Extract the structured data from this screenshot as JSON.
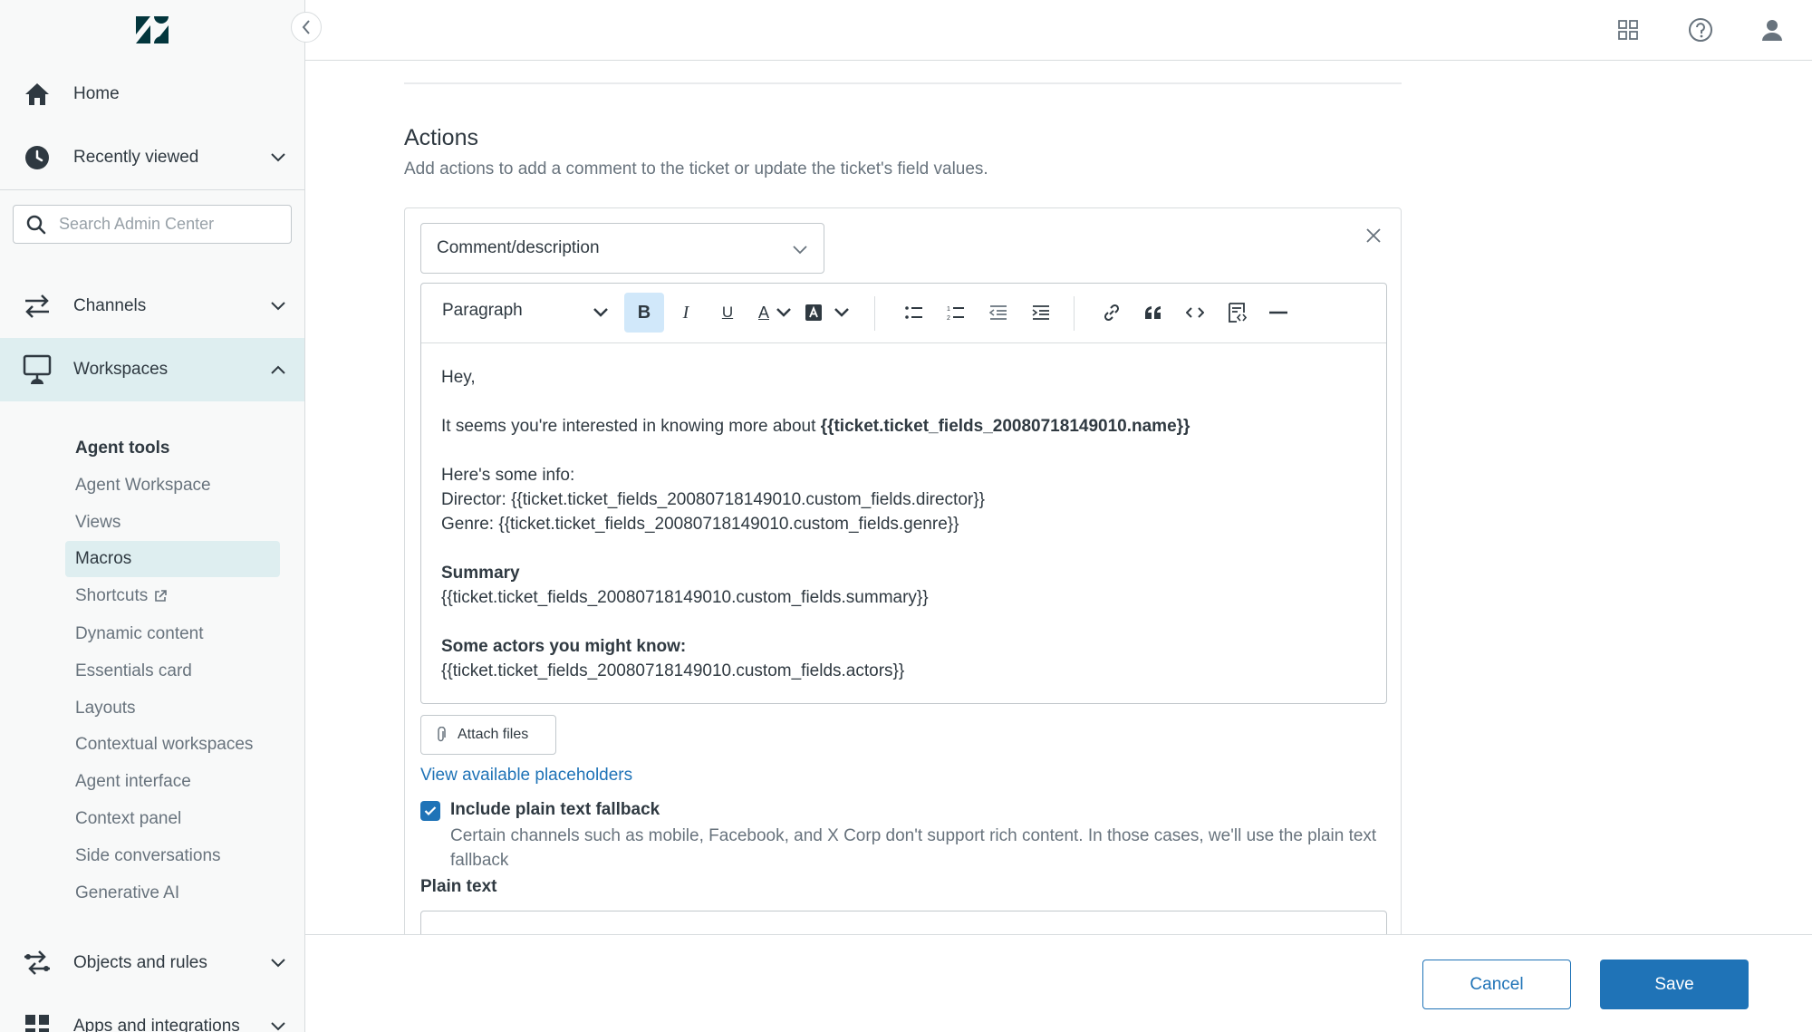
{
  "sidebar": {
    "logo": "zendesk-logo",
    "collapse_icon": "chevron-left-icon",
    "nav": {
      "home": "Home",
      "recently_viewed": "Recently viewed",
      "channels": "Channels",
      "workspaces": "Workspaces",
      "objects_rules": "Objects and rules",
      "apps_integrations": "Apps and integrations"
    },
    "search_placeholder": "Search Admin Center",
    "agent_tools_heading": "Agent tools",
    "sub_items": [
      "Agent Workspace",
      "Views",
      "Macros",
      "Shortcuts",
      "Dynamic content",
      "Essentials card",
      "Layouts",
      "Contextual workspaces",
      "Agent interface",
      "Context panel",
      "Side conversations",
      "Generative AI"
    ],
    "active_sub_item": "Macros"
  },
  "topbar": {
    "icons": [
      "apps-grid-icon",
      "help-icon",
      "user-icon"
    ]
  },
  "main": {
    "actions_title": "Actions",
    "actions_description": "Add actions to add a comment to the ticket or update the ticket's field values.",
    "action_select_value": "Comment/description",
    "toolbar": {
      "paragraph": "Paragraph",
      "bold": "B",
      "italic": "I",
      "underline": "U",
      "text_color": "A"
    },
    "content": {
      "greeting": "Hey,",
      "interest_prefix": "It seems you're interested in knowing more about ",
      "interest_placeholder": "{{ticket.ticket_fields_20080718149010.name}}",
      "info_heading": "Here's some info:",
      "director": "Director: {{ticket.ticket_fields_20080718149010.custom_fields.director}}",
      "genre": "Genre: {{ticket.ticket_fields_20080718149010.custom_fields.genre}}",
      "summary_heading": "Summary",
      "summary": "{{ticket.ticket_fields_20080718149010.custom_fields.summary}}",
      "actors_heading": "Some actors you might know:",
      "actors": "{{ticket.ticket_fields_20080718149010.custom_fields.actors}}"
    },
    "attach_files": "Attach files",
    "placeholders_link": "View available placeholders",
    "plain_text_fallback": {
      "checked": true,
      "label": "Include plain text fallback",
      "hint": "Certain channels such as mobile, Facebook, and X Corp don't support rich content. In those cases, we'll use the plain text fallback"
    },
    "plain_text_label": "Plain text"
  },
  "footer": {
    "cancel": "Cancel",
    "save": "Save"
  },
  "colors": {
    "accent": "#1f73b7",
    "active_bg": "#deeef0",
    "sidebar_bg": "#f8f9f9"
  }
}
